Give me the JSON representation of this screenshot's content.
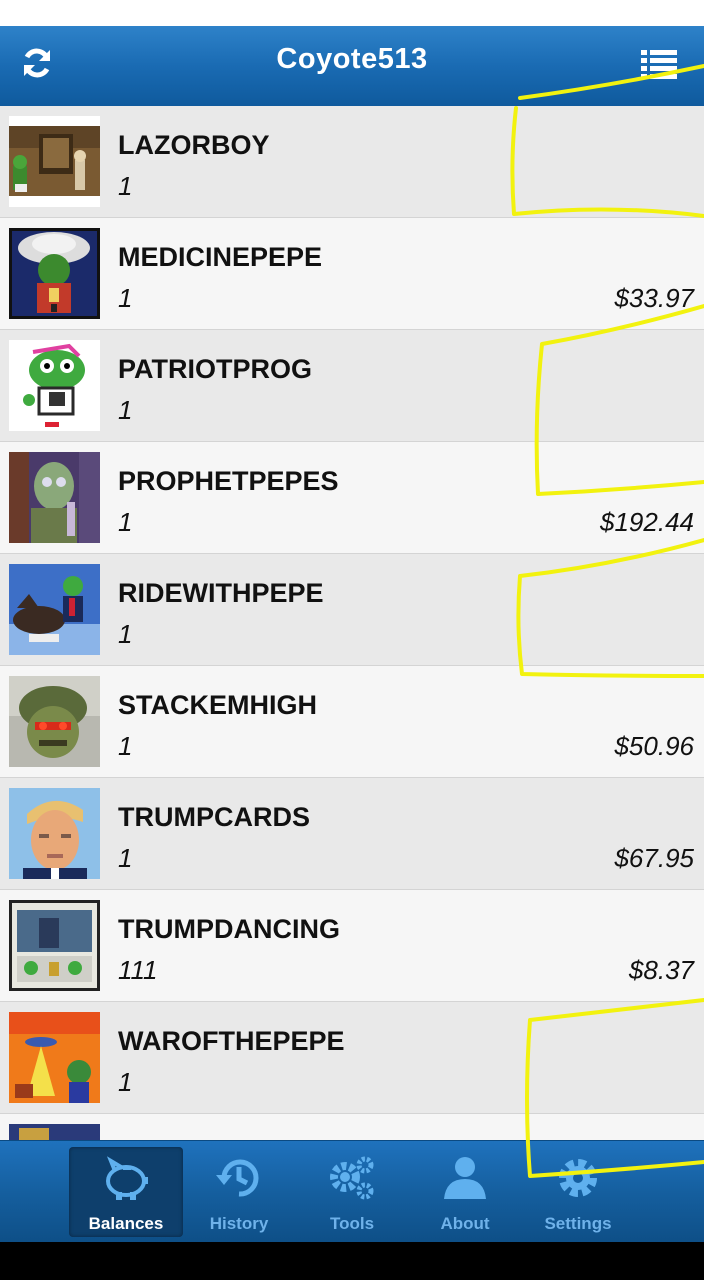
{
  "header": {
    "title": "Coyote513",
    "refresh_icon": "refresh-icon",
    "menu_icon": "list-menu-icon",
    "color": "#1a6bb3"
  },
  "balances": [
    {
      "name": "LAZORBOY",
      "quantity": "1",
      "value": ""
    },
    {
      "name": "MEDICINEPEPE",
      "quantity": "1",
      "value": "$33.97"
    },
    {
      "name": "PATRIOTPROG",
      "quantity": "1",
      "value": ""
    },
    {
      "name": "PROPHETPEPES",
      "quantity": "1",
      "value": "$192.44"
    },
    {
      "name": "RIDEWITHPEPE",
      "quantity": "1",
      "value": ""
    },
    {
      "name": "STACKEMHIGH",
      "quantity": "1",
      "value": "$50.96"
    },
    {
      "name": "TRUMPCARDS",
      "quantity": "1",
      "value": "$67.95"
    },
    {
      "name": "TRUMPDANCING",
      "quantity": "111",
      "value": "$8.37"
    },
    {
      "name": "WAROFTHEPEPE",
      "quantity": "1",
      "value": ""
    }
  ],
  "tabs": [
    {
      "label": "Balances",
      "icon": "piggy-bank-icon",
      "active": true
    },
    {
      "label": "History",
      "icon": "history-icon",
      "active": false
    },
    {
      "label": "Tools",
      "icon": "gears-icon",
      "active": false
    },
    {
      "label": "About",
      "icon": "person-icon",
      "active": false
    },
    {
      "label": "Settings",
      "icon": "gear-icon",
      "active": false
    }
  ],
  "colors": {
    "accent": "#1a6bb3",
    "tab_inactive_label": "#6fb2ea",
    "highlight_marker": "#f2f20f"
  }
}
